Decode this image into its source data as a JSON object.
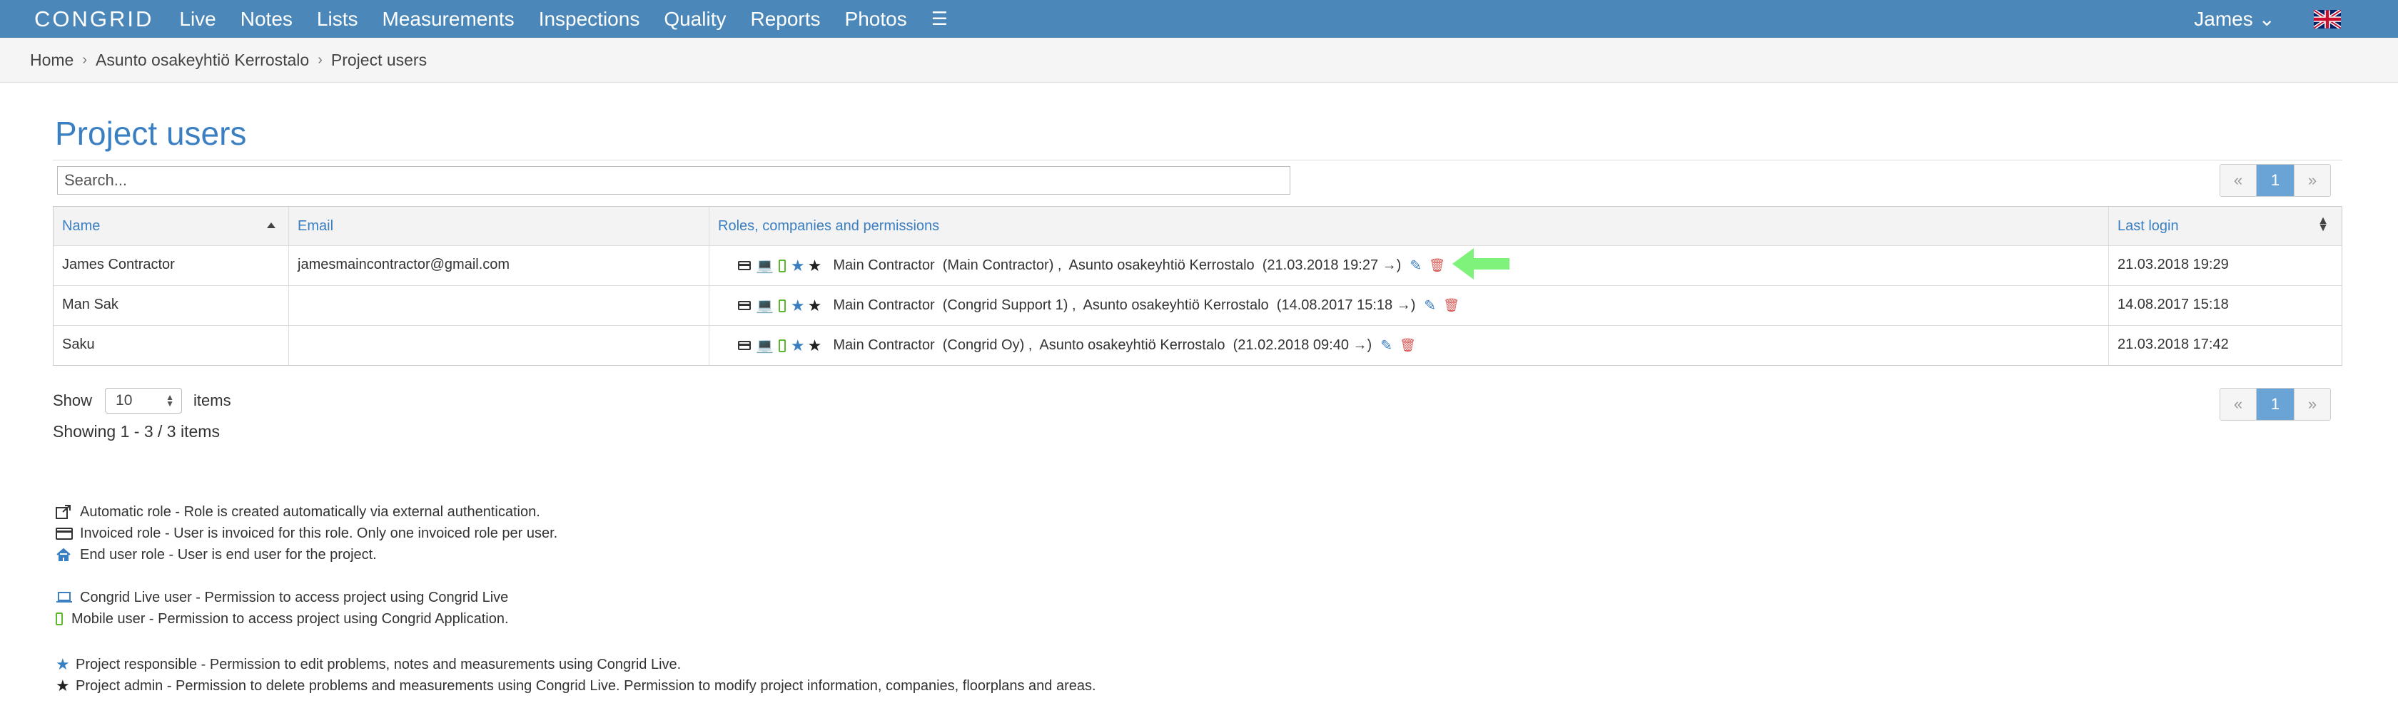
{
  "nav": {
    "logo": "CONGRID",
    "items": [
      "Live",
      "Notes",
      "Lists",
      "Measurements",
      "Inspections",
      "Quality",
      "Reports",
      "Photos"
    ],
    "user": "James ⌄"
  },
  "breadcrumb": [
    "Home",
    "Asunto osakeyhtiö Kerrostalo",
    "Project users"
  ],
  "page_title": "Project users",
  "search": {
    "placeholder": "Search..."
  },
  "pager": {
    "prev": "«",
    "current": "1",
    "next": "»"
  },
  "table": {
    "headers": {
      "name": "Name",
      "email": "Email",
      "roles": "Roles, companies and permissions",
      "last_login": "Last login"
    },
    "rows": [
      {
        "name": "James Contractor",
        "email": "jamesmaincontractor@gmail.com",
        "roles": "Main Contractor  (Main Contractor) ,  Asunto osakeyhtiö Kerrostalo  (21.03.2018 19:27 →)",
        "last_login": "21.03.2018 19:29"
      },
      {
        "name": "Man Sak",
        "email": "",
        "roles": "Main Contractor  (Congrid Support 1) ,  Asunto osakeyhtiö Kerrostalo  (14.08.2017 15:18 →)",
        "last_login": "14.08.2017 15:18"
      },
      {
        "name": "Saku",
        "email": "",
        "roles": "Main Contractor  (Congrid Oy) ,  Asunto osakeyhtiö Kerrostalo  (21.02.2018 09:40 →)",
        "last_login": "21.03.2018 17:42"
      }
    ]
  },
  "show": {
    "label": "Show",
    "value": "10",
    "suffix": "items"
  },
  "showing": "Showing 1 - 3 / 3 items",
  "legend": [
    {
      "icon": "external-link-icon",
      "text": "Automatic role - Role is created automatically via external authentication."
    },
    {
      "icon": "credit-card-icon",
      "text": "Invoiced role - User is invoiced for this role. Only one invoiced role per user."
    },
    {
      "icon": "home-icon",
      "text": "End user role - User is end user for the project."
    },
    {
      "icon": "laptop-icon",
      "text": "Congrid Live user - Permission to access project using Congrid Live"
    },
    {
      "icon": "mobile-icon",
      "text": "Mobile user - Permission to access project using Congrid Application."
    },
    {
      "icon": "star-blue-icon",
      "text": "Project responsible - Permission to edit problems, notes and measurements using Congrid Live."
    },
    {
      "icon": "star-black-icon",
      "text": "Project admin - Permission to delete problems and measurements using Congrid Live. Permission to modify project information, companies, floorplans and areas."
    }
  ],
  "colors": {
    "navbar": "#4b87b8",
    "link": "#3a7fc1",
    "highlight_arrow": "#7ef27a",
    "delete": "#d9534f",
    "mobile": "#5cb82e"
  }
}
